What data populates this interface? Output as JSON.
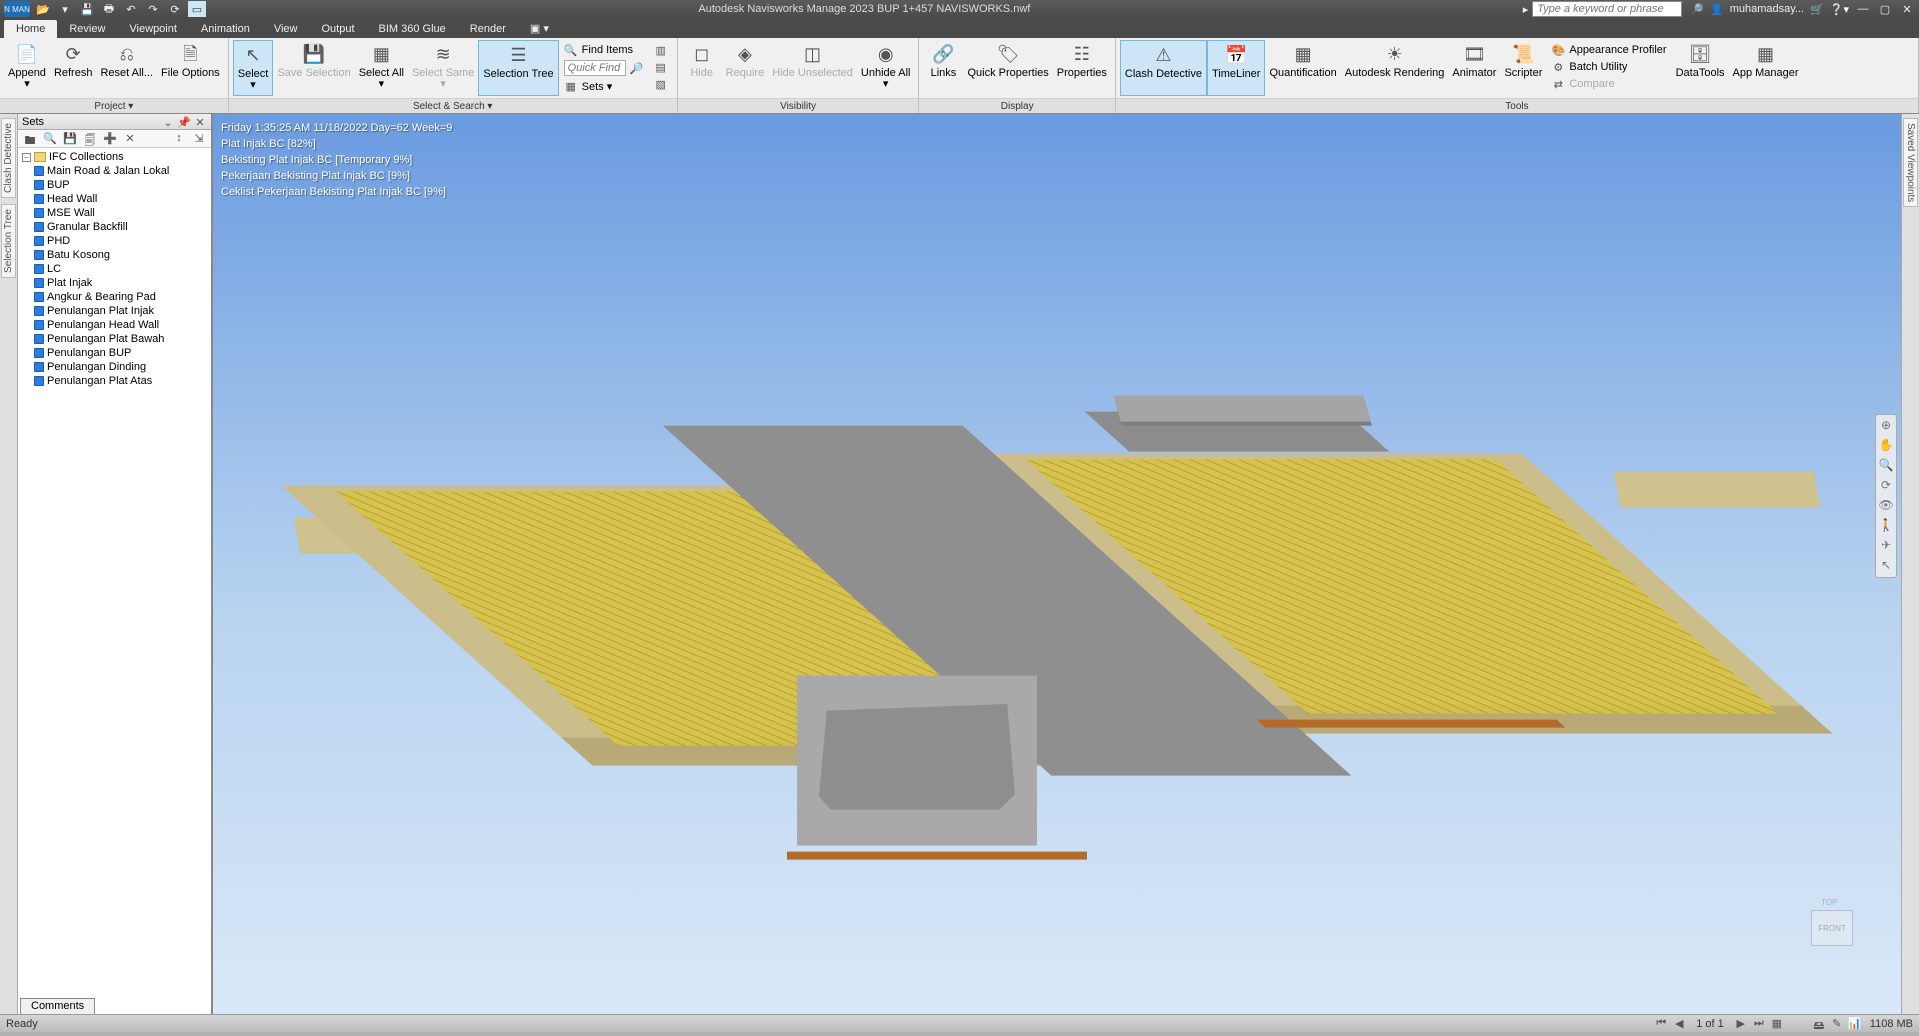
{
  "app": {
    "title": "Autodesk Navisworks Manage 2023   BUP 1+457 NAVISWORKS.nwf",
    "search_placeholder": "Type a keyword or phrase",
    "user": "muhamadsay..."
  },
  "tabs": {
    "home": "Home",
    "review": "Review",
    "viewpoint": "Viewpoint",
    "animation": "Animation",
    "view": "View",
    "output": "Output",
    "bim360": "BIM 360 Glue",
    "render": "Render"
  },
  "ribbon": {
    "project": {
      "title": "Project ▾",
      "append": "Append",
      "refresh": "Refresh",
      "reset": "Reset All...",
      "file_options": "File Options"
    },
    "select": {
      "title": "Select & Search ▾",
      "select": "Select",
      "save_sel": "Save Selection",
      "select_all": "Select All",
      "select_same": "Select Same",
      "sel_tree": "Selection Tree",
      "find_items": "Find Items",
      "quick_find_ph": "Quick Find",
      "sets": "Sets ▾"
    },
    "visibility": {
      "title": "Visibility",
      "hide": "Hide",
      "require": "Require",
      "hide_unsel": "Hide Unselected",
      "unhide": "Unhide All"
    },
    "display": {
      "title": "Display",
      "links": "Links",
      "quick_props": "Quick Properties",
      "properties": "Properties"
    },
    "tools": {
      "title": "Tools",
      "clash": "Clash Detective",
      "timeliner": "TimeLiner",
      "quant": "Quantification",
      "autodesk_render": "Autodesk Rendering",
      "animator": "Animator",
      "scripter": "Scripter",
      "appearance": "Appearance Profiler",
      "batch": "Batch Utility",
      "compare": "Compare",
      "datatools": "DataTools",
      "appmgr": "App Manager"
    }
  },
  "left_rail": {
    "clash": "Clash Detective",
    "seltree": "Selection Tree"
  },
  "right_rail": {
    "saved": "Saved Viewpoints"
  },
  "sets": {
    "title": "Sets",
    "root": "IFC Collections",
    "items": [
      "Main Road & Jalan Lokal",
      "BUP",
      "Head Wall",
      "MSE Wall",
      "Granular Backfill",
      "PHD",
      "Batu Kosong",
      "LC",
      "Plat Injak",
      "Angkur & Bearing Pad",
      "Penulangan Plat Injak",
      "Penulangan Head Wall",
      "Penulangan Plat Bawah",
      "Penulangan BUP",
      "Penulangan Dinding",
      "Penulangan Plat Atas"
    ]
  },
  "overlay": {
    "l1": "Friday 1:35:25 AM 11/18/2022 Day=62 Week=9",
    "l2": "Plat Injak BC [82%]",
    "l3": "Bekisting Plat Injak BC [Temporary 9%]",
    "l4": "Pekerjaan Bekisting Plat Injak BC [9%]",
    "l5": "Ceklist Pekerjaan Bekisting Plat Injak BC [9%]"
  },
  "navcube": {
    "front": "FRONT",
    "top": "TOP"
  },
  "comments_tab": "Comments",
  "status": {
    "ready": "Ready",
    "pages": "1 of 1",
    "mem": "1108 MB"
  }
}
